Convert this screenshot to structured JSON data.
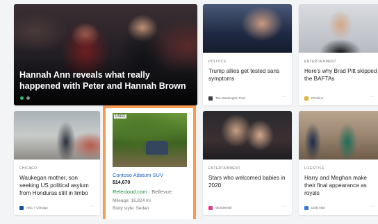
{
  "hero": {
    "title": "Hannah Ann reveals what really happened with Peter and Hannah Brown"
  },
  "cards": [
    {
      "category": "POLITICS",
      "title": "Trump allies get tested sans symptoms",
      "source": "The Washington Post"
    },
    {
      "category": "ENTERTAINMENT",
      "title": "Here's why Brad Pitt skipped the BAFTAs",
      "source": "E!Online"
    },
    {
      "category": "CHICAGO",
      "title": "Waukegan mother, son seeking US political asylum from Honduras still in limbo",
      "source": "ABC 7 Chicago"
    },
    {
      "category": "ENTERTAINMENT",
      "title": "Stars who welcomed babies in 2020",
      "source": "Wonderwall"
    },
    {
      "category": "LIFESTYLE",
      "title": "Harry and Meghan make their final appearance as royals",
      "source": "Daily Mail"
    }
  ],
  "ad": {
    "badge": "USED",
    "name": "Contoso Adatum SUV",
    "price": "$14,670",
    "site": "Relecloud.com",
    "location": "· Bellevue",
    "mileage": "Mileage: 16,824 mi",
    "body": "Body style: Sedan"
  },
  "more_glyph": "···",
  "colors": {
    "ad_highlight": "#f79a52",
    "link_blue": "#1a64c8",
    "site_green": "#108a3a",
    "carousel_active": "#2dbd6e"
  }
}
